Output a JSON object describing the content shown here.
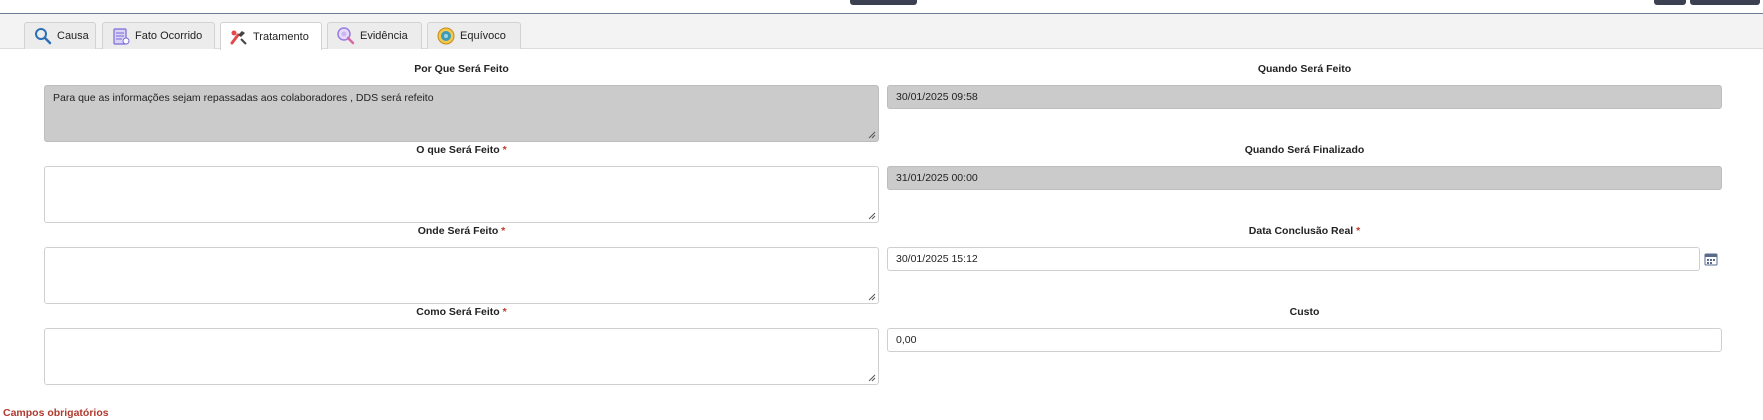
{
  "tabs": [
    {
      "label": "Causa",
      "icon": "magnifier-icon",
      "active": false
    },
    {
      "label": "Fato Ocorrido",
      "icon": "document-icon",
      "active": false
    },
    {
      "label": "Tratamento",
      "icon": "tools-icon",
      "active": true
    },
    {
      "label": "Evidência",
      "icon": "evidence-search-icon",
      "active": false
    },
    {
      "label": "Equívoco",
      "icon": "badge-icon",
      "active": false
    }
  ],
  "form": {
    "por_que": {
      "label": "Por Que Será Feito",
      "value": "Para que as informações sejam repassadas aos colaboradores , DDS será refeito"
    },
    "o_que": {
      "label": "O que Será Feito",
      "required_mark": "*",
      "value": ""
    },
    "onde": {
      "label": "Onde Será Feito",
      "required_mark": "*",
      "value": ""
    },
    "como": {
      "label": "Como Será Feito",
      "required_mark": "*",
      "value": ""
    },
    "quando": {
      "label": "Quando Será Feito",
      "value": "30/01/2025 09:58"
    },
    "quando_finalizado": {
      "label": "Quando Será Finalizado",
      "value": "31/01/2025 00:00"
    },
    "data_conclusao": {
      "label": "Data Conclusão Real",
      "required_mark": "*",
      "value": "30/01/2025 15:12"
    },
    "custo": {
      "label": "Custo",
      "value": "0,00"
    }
  },
  "footer": {
    "required_note": "Campos obrigatórios"
  },
  "colors": {
    "readonly_bg": "#cbcbcb",
    "required": "#c0392b",
    "accent_bar": "#6d7a96"
  }
}
